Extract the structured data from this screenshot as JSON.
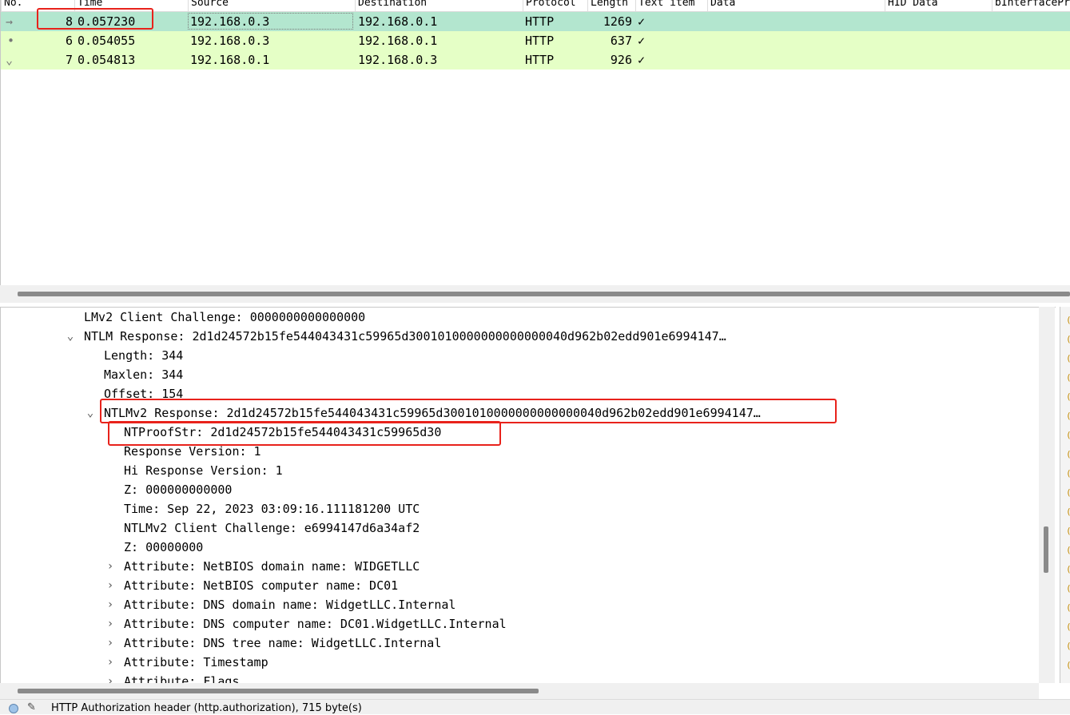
{
  "columns": [
    "No.",
    "Time",
    "Source",
    "Destination",
    "Protocol",
    "Length",
    "Text item",
    "Data",
    "HID Data",
    "bInterfacePr"
  ],
  "packets": [
    {
      "no": "8",
      "time": "0.057230",
      "source": "192.168.0.3",
      "destination": "192.168.0.1",
      "protocol": "HTTP",
      "length": "1269",
      "text_item": "✓"
    },
    {
      "no": "6",
      "time": "0.054055",
      "source": "192.168.0.3",
      "destination": "192.168.0.1",
      "protocol": "HTTP",
      "length": "637",
      "text_item": "✓"
    },
    {
      "no": "7",
      "time": "0.054813",
      "source": "192.168.0.1",
      "destination": "192.168.0.3",
      "protocol": "HTTP",
      "length": "926",
      "text_item": "✓"
    }
  ],
  "row_markers": [
    "→",
    "•",
    "⌄"
  ],
  "details": [
    {
      "text": "LMv2 Client Challenge: 0000000000000000",
      "expander": ""
    },
    {
      "text": "NTLM Response: 2d1d24572b15fe544043431c59965d3001010000000000000040d962b02edd901e6994147…",
      "expander": "⌄"
    },
    {
      "text": "Length: 344",
      "expander": ""
    },
    {
      "text": "Maxlen: 344",
      "expander": ""
    },
    {
      "text": "Offset: 154",
      "expander": ""
    },
    {
      "text": "NTLMv2 Response: 2d1d24572b15fe544043431c59965d3001010000000000000040d962b02edd901e6994147…",
      "expander": "⌄"
    },
    {
      "text": "NTProofStr: 2d1d24572b15fe544043431c59965d30",
      "expander": ""
    },
    {
      "text": "Response Version: 1",
      "expander": ""
    },
    {
      "text": "Hi Response Version: 1",
      "expander": ""
    },
    {
      "text": "Z: 000000000000",
      "expander": ""
    },
    {
      "text": "Time: Sep 22, 2023 03:09:16.111181200 UTC",
      "expander": ""
    },
    {
      "text": "NTLMv2 Client Challenge: e6994147d6a34af2",
      "expander": ""
    },
    {
      "text": "Z: 00000000",
      "expander": ""
    },
    {
      "text": "Attribute: NetBIOS domain name: WIDGETLLC",
      "expander": "›"
    },
    {
      "text": "Attribute: NetBIOS computer name: DC01",
      "expander": "›"
    },
    {
      "text": "Attribute: DNS domain name: WidgetLLC.Internal",
      "expander": "›"
    },
    {
      "text": "Attribute: DNS computer name: DC01.WidgetLLC.Internal",
      "expander": "›"
    },
    {
      "text": "Attribute: DNS tree name: WidgetLLC.Internal",
      "expander": "›"
    },
    {
      "text": "Attribute: Timestamp",
      "expander": "›"
    },
    {
      "text": "Attribute: Flags",
      "expander": "›"
    }
  ],
  "status": {
    "edit_icon": "edit-icon",
    "text": "HTTP Authorization header (http.authorization), 715 byte(s)"
  },
  "colors": {
    "row_selected": "#b3e6cf",
    "row_http": "#e5ffc6",
    "highlight_box": "#e8221b"
  }
}
